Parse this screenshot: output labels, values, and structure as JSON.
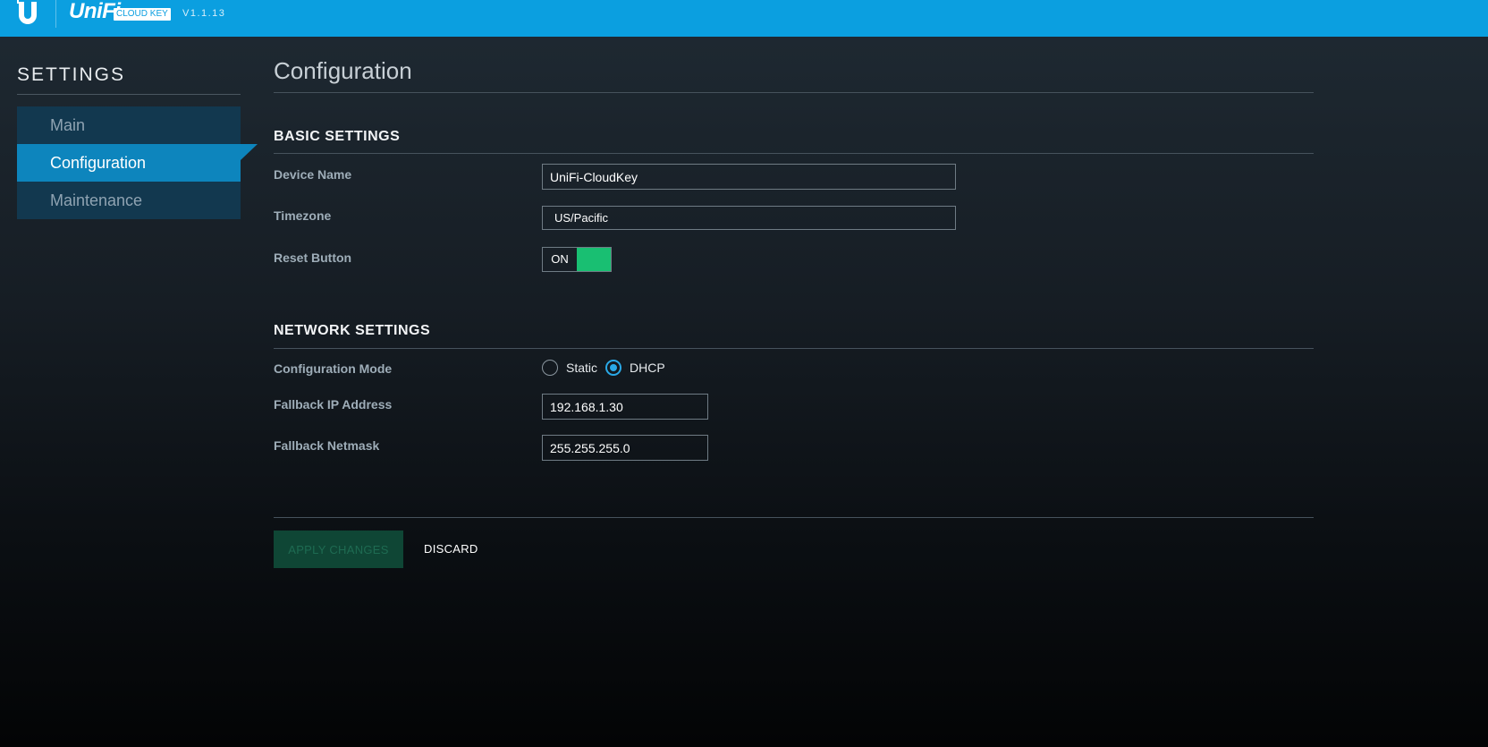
{
  "header": {
    "brand": "UniFi",
    "badge": "CLOUD KEY",
    "version": "V1.1.13"
  },
  "sidebar": {
    "title": "SETTINGS",
    "items": [
      {
        "label": "Main",
        "active": false
      },
      {
        "label": "Configuration",
        "active": true
      },
      {
        "label": "Maintenance",
        "active": false
      }
    ]
  },
  "main": {
    "title": "Configuration",
    "basic": {
      "heading": "BASIC SETTINGS",
      "device_name_label": "Device Name",
      "device_name_value": "UniFi-CloudKey",
      "timezone_label": "Timezone",
      "timezone_value": "US/Pacific",
      "reset_label": "Reset Button",
      "reset_state": "ON"
    },
    "network": {
      "heading": "NETWORK SETTINGS",
      "mode_label": "Configuration Mode",
      "mode_options": [
        "Static",
        "DHCP"
      ],
      "mode_selected": "DHCP",
      "fallback_ip_label": "Fallback IP Address",
      "fallback_ip_value": "192.168.1.30",
      "fallback_netmask_label": "Fallback Netmask",
      "fallback_netmask_value": "255.255.255.0"
    },
    "actions": {
      "apply": "APPLY CHANGES",
      "discard": "DISCARD"
    }
  },
  "colors": {
    "topbar": "#0b9fe0",
    "nav_active": "#0d85bd",
    "toggle_on": "#19bf72",
    "radio_selected": "#2aa9e7"
  },
  "icons": [
    "ubiquiti-logo-icon"
  ]
}
